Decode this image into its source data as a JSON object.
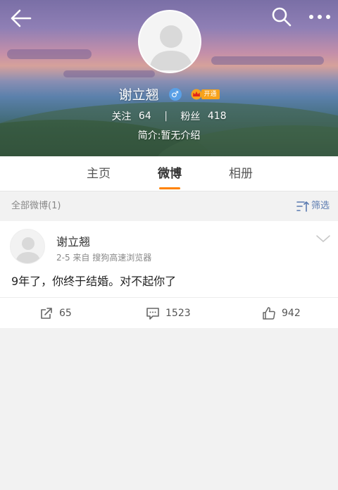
{
  "header": {
    "username": "谢立翘",
    "vip_label": "开通",
    "following_label": "关注",
    "following_count": "64",
    "followers_label": "粉丝",
    "followers_count": "418",
    "bio": "简介:暂无介绍",
    "gender_symbol": "♂"
  },
  "tabs": [
    {
      "label": "主页",
      "active": false
    },
    {
      "label": "微博",
      "active": true
    },
    {
      "label": "相册",
      "active": false
    }
  ],
  "filter": {
    "count_label": "全部微博(1)",
    "filter_label": "筛选"
  },
  "post": {
    "author": "谢立翘",
    "meta": "2-5  来自 搜狗高速浏览器",
    "text": "9年了，你终于结婚。对不起你了",
    "reposts": "65",
    "comments": "1523",
    "likes": "942"
  },
  "colors": {
    "accent": "#ff8200",
    "link": "#5b7bb0",
    "badge_blue": "#5aa0e6",
    "vip_gold": "#f7a21b"
  },
  "icons": [
    "back-arrow-icon",
    "search-icon",
    "more-icon",
    "male-icon",
    "crown-icon",
    "filter-icon",
    "chevron-down-icon",
    "repost-icon",
    "comment-icon",
    "like-icon"
  ]
}
